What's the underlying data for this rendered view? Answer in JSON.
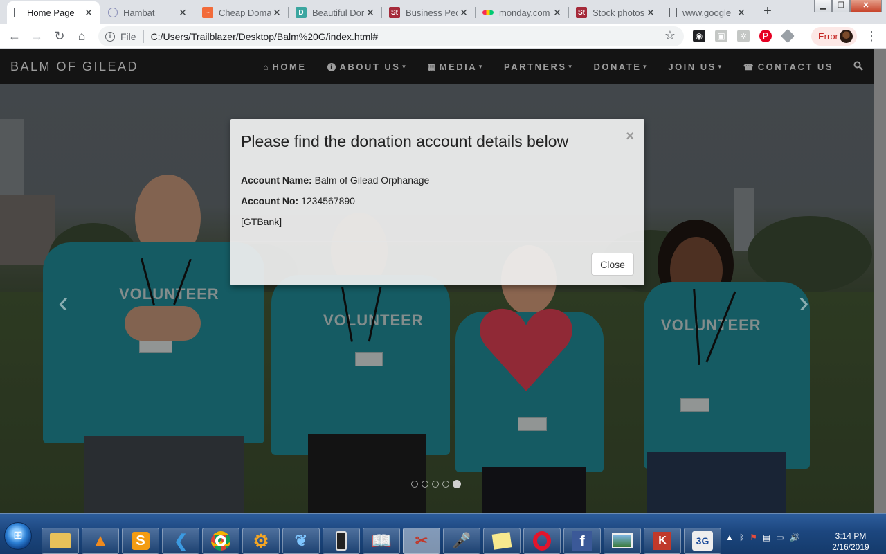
{
  "browser": {
    "tabs": [
      {
        "title": "Home Page",
        "favicon": "page-icon",
        "active": true
      },
      {
        "title": "Hambat",
        "favicon": "globe-icon",
        "active": false
      },
      {
        "title": "Cheap Doma",
        "favicon": "chart-logo-icon",
        "active": false
      },
      {
        "title": "Beautiful Dor",
        "favicon": "d-logo-icon",
        "active": false
      },
      {
        "title": "Business Peo",
        "favicon": "st-logo-icon",
        "active": false
      },
      {
        "title": "monday.com",
        "favicon": "monday-logo-icon",
        "active": false
      },
      {
        "title": "Stock photos",
        "favicon": "st-logo-icon",
        "active": false
      },
      {
        "title": "www.google",
        "favicon": "page-icon",
        "active": false
      }
    ],
    "address": {
      "scheme_label": "File",
      "url": "C:/Users/Trailblazer/Desktop/Balm%20G/index.html#"
    },
    "profile_status": "Error"
  },
  "site": {
    "brand": "BALM OF GILEAD",
    "nav": [
      {
        "label": "HOME",
        "icon": "home-icon",
        "dropdown": false
      },
      {
        "label": "ABOUT US",
        "icon": "info-icon",
        "dropdown": true
      },
      {
        "label": "MEDIA",
        "icon": "film-icon",
        "dropdown": true
      },
      {
        "label": "PARTNERS",
        "icon": "",
        "dropdown": true
      },
      {
        "label": "DONATE",
        "icon": "",
        "dropdown": true
      },
      {
        "label": "JOIN US",
        "icon": "",
        "dropdown": true
      },
      {
        "label": "CONTACT US",
        "icon": "phone-icon",
        "dropdown": false
      }
    ],
    "hero": {
      "shirt_text": "VOLUNTEER",
      "slide_count": 5,
      "active_slide": 5
    },
    "modal": {
      "title": "Please find the donation account details below",
      "close_symbol": "×",
      "account_name_label": "Account Name:",
      "account_name": "Balm of Gilead Orphanage",
      "account_no_label": "Account No:",
      "account_no": "1234567890",
      "bank": "[GTBank]",
      "close_button": "Close"
    }
  },
  "taskbar": {
    "apps": [
      "file-explorer-icon",
      "vlc-icon",
      "sublime-text-icon",
      "vscode-icon",
      "chrome-icon",
      "settings-gear-icon",
      "edge-bird-icon",
      "phone-app-icon",
      "book-icon",
      "snipping-tool-icon",
      "microphone-icon",
      "sticky-notes-icon",
      "opera-icon",
      "facebook-icon",
      "photo-viewer-icon",
      "kaspersky-icon",
      "3g-modem-icon"
    ],
    "clock": {
      "time": "3:14 PM",
      "date": "2/16/2019"
    }
  },
  "colors": {
    "navbar": "#141414",
    "shirt": "#1e7f8a",
    "taskbar": "#1c467e",
    "heart": "#c83a4b"
  }
}
